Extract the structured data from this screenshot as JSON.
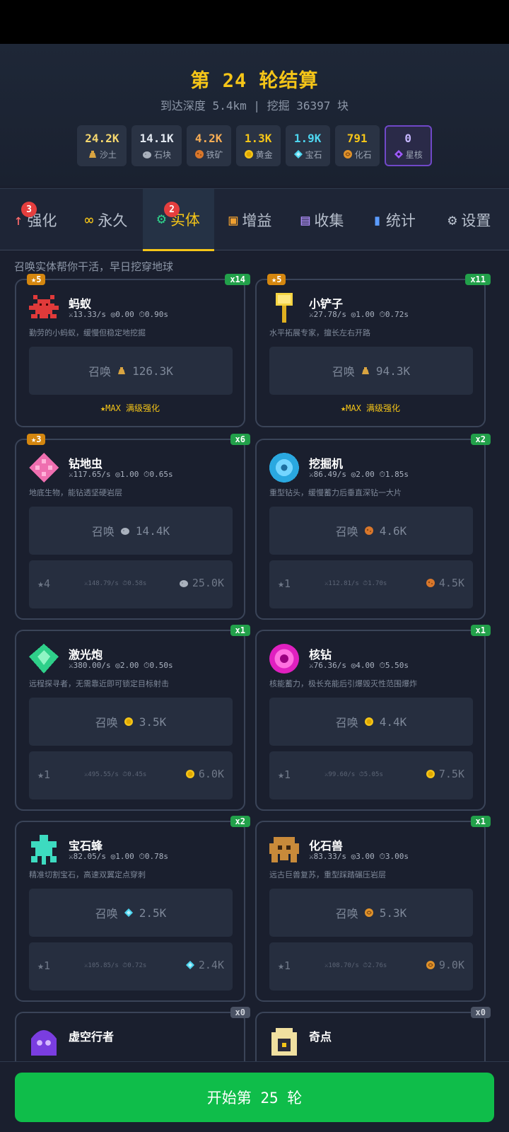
{
  "summary": {
    "title": "第 24 轮结算",
    "subtitle": "到达深度 5.4km | 挖掘 36397 块",
    "resources": [
      {
        "value": "24.2K",
        "label": "沙土",
        "color": "#f5d76e",
        "icon": "sand-icon"
      },
      {
        "value": "14.1K",
        "label": "石块",
        "color": "#e2e8f0",
        "icon": "stone-icon"
      },
      {
        "value": "4.2K",
        "label": "铁矿",
        "color": "#f6ad55",
        "icon": "iron-ore-icon"
      },
      {
        "value": "1.3K",
        "label": "黄金",
        "color": "#f5c518",
        "icon": "gold-icon"
      },
      {
        "value": "1.9K",
        "label": "宝石",
        "color": "#4dd6f0",
        "icon": "gem-icon"
      },
      {
        "value": "791",
        "label": "化石",
        "color": "#f5c518",
        "icon": "fossil-icon"
      },
      {
        "value": "0",
        "label": "星核",
        "color": "#c4b5fd",
        "icon": "star-core-icon"
      }
    ]
  },
  "tabs": [
    {
      "label": "强化",
      "icon": "↑",
      "badge": "3"
    },
    {
      "label": "永久",
      "icon": "∞",
      "badge": ""
    },
    {
      "label": "实体",
      "icon": "⚙",
      "badge": "2"
    },
    {
      "label": "增益",
      "icon": "▣",
      "badge": ""
    },
    {
      "label": "收集",
      "icon": "▤",
      "badge": ""
    },
    {
      "label": "统计",
      "icon": "▮",
      "badge": ""
    },
    {
      "label": "设置",
      "icon": "⚙",
      "badge": ""
    }
  ],
  "hint": "召唤实体帮你干活，早日挖穿地球",
  "entities": [
    {
      "name": "蚂蚁",
      "stars": "★5",
      "count": "x14",
      "stats": "⚔13.33/s ◎0.00 ⏱0.90s",
      "desc": "勤劳的小蚂蚁，缓慢但稳定地挖掘",
      "summon_label": "召唤",
      "summon_cost": "126.3K",
      "currency_icon": "sand-icon",
      "max_text": "★MAX 满级强化",
      "up_level": "",
      "up_stats": "",
      "up_cost": ""
    },
    {
      "name": "小铲子",
      "stars": "★5",
      "count": "x11",
      "stats": "⚔27.78/s ◎1.00 ⏱0.72s",
      "desc": "水平拓展专家，擅长左右开路",
      "summon_label": "召唤",
      "summon_cost": "94.3K",
      "currency_icon": "sand-icon",
      "max_text": "★MAX 满级强化",
      "up_level": "",
      "up_stats": "",
      "up_cost": ""
    },
    {
      "name": "钻地虫",
      "stars": "★3",
      "count": "x6",
      "stats": "⚔117.65/s ◎1.00 ⏱0.65s",
      "desc": "地底生物，能钻透坚硬岩层",
      "summon_label": "召唤",
      "summon_cost": "14.4K",
      "currency_icon": "stone-icon",
      "max_text": "",
      "up_level": "★4",
      "up_stats": "⚔148.79/s ⏱0.58s",
      "up_cost": "25.0K"
    },
    {
      "name": "挖掘机",
      "stars": "",
      "count": "x2",
      "stats": "⚔86.49/s ◎2.00 ⏱1.85s",
      "desc": "重型钻头，缓慢蓄力后垂直深钻一大片",
      "summon_label": "召唤",
      "summon_cost": "4.6K",
      "currency_icon": "iron-ore-icon",
      "max_text": "",
      "up_level": "★1",
      "up_stats": "⚔112.81/s ⏱1.70s",
      "up_cost": "4.5K"
    },
    {
      "name": "激光炮",
      "stars": "",
      "count": "x1",
      "stats": "⚔380.00/s ◎2.00 ⏱0.50s",
      "desc": "远程探寻者，无需靠近即可锁定目标射击",
      "summon_label": "召唤",
      "summon_cost": "3.5K",
      "currency_icon": "gold-icon",
      "max_text": "",
      "up_level": "★1",
      "up_stats": "⚔495.55/s ⏱0.45s",
      "up_cost": "6.0K"
    },
    {
      "name": "核钻",
      "stars": "",
      "count": "x1",
      "stats": "⚔76.36/s ◎4.00 ⏱5.50s",
      "desc": "核能蓄力，极长充能后引爆毁灭性范围爆炸",
      "summon_label": "召唤",
      "summon_cost": "4.4K",
      "currency_icon": "gold-icon",
      "max_text": "",
      "up_level": "★1",
      "up_stats": "⚔99.60/s ⏱5.05s",
      "up_cost": "7.5K"
    },
    {
      "name": "宝石蜂",
      "stars": "",
      "count": "x2",
      "stats": "⚔82.05/s ◎1.00 ⏱0.78s",
      "desc": "精准切割宝石，高速双翼定点穿刺",
      "summon_label": "召唤",
      "summon_cost": "2.5K",
      "currency_icon": "gem-icon",
      "max_text": "",
      "up_level": "★1",
      "up_stats": "⚔105.85/s ⏱0.72s",
      "up_cost": "2.4K"
    },
    {
      "name": "化石兽",
      "stars": "",
      "count": "x1",
      "stats": "⚔83.33/s ◎3.00 ⏱3.00s",
      "desc": "远古巨兽复苏，重型踩踏碾压岩层",
      "summon_label": "召唤",
      "summon_cost": "5.3K",
      "currency_icon": "fossil-icon",
      "max_text": "",
      "up_level": "★1",
      "up_stats": "⚔108.70/s ⏱2.76s",
      "up_cost": "9.0K"
    },
    {
      "name": "虚空行者",
      "stars": "",
      "count": "x0",
      "stats": "",
      "desc": "",
      "summon_label": "",
      "summon_cost": "",
      "currency_icon": "",
      "max_text": "",
      "up_level": "",
      "up_stats": "",
      "up_cost": ""
    },
    {
      "name": "奇点",
      "stars": "",
      "count": "x0",
      "stats": "",
      "desc": "",
      "summon_label": "",
      "summon_cost": "",
      "currency_icon": "",
      "max_text": "",
      "up_level": "",
      "up_stats": "",
      "up_cost": ""
    }
  ],
  "start_button": "开始第 25 轮"
}
